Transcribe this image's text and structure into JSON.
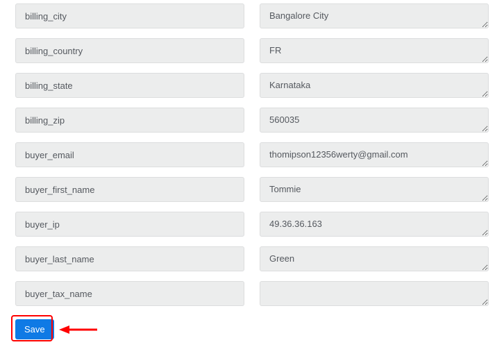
{
  "fields": [
    {
      "key": "billing_city",
      "value": "Bangalore City"
    },
    {
      "key": "billing_country",
      "value": "FR"
    },
    {
      "key": "billing_state",
      "value": "Karnataka"
    },
    {
      "key": "billing_zip",
      "value": "560035"
    },
    {
      "key": "buyer_email",
      "value": "thomipson12356werty@gmail.com"
    },
    {
      "key": "buyer_first_name",
      "value": "Tommie"
    },
    {
      "key": "buyer_ip",
      "value": "49.36.36.163"
    },
    {
      "key": "buyer_last_name",
      "value": "Green"
    },
    {
      "key": "buyer_tax_name",
      "value": ""
    }
  ],
  "footer": {
    "save_label": "Save"
  },
  "colors": {
    "accent": "#0f7ae5",
    "callout": "#ff0000",
    "field_bg": "#eceded"
  }
}
